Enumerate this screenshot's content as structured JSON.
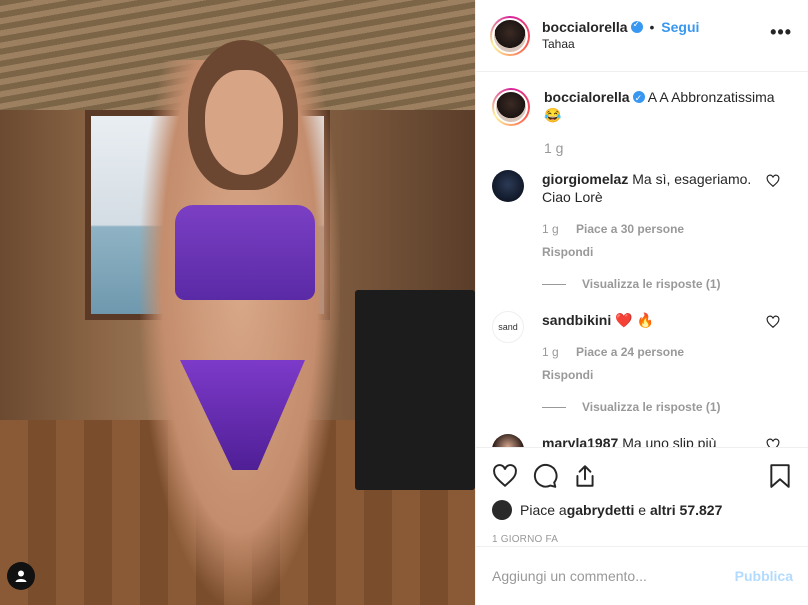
{
  "post": {
    "username": "boccialorella",
    "follow_label": "Segui",
    "separator": "•",
    "location": "Tahaa",
    "more_label": "•••"
  },
  "caption": {
    "username": "boccialorella",
    "text": "A A Abbronzatissima",
    "emoji": "😂",
    "time": "1 g"
  },
  "comments": [
    {
      "username": "giorgiomelaz",
      "text": "Ma sì, esageriamo. Ciao Lorè",
      "time": "1 g",
      "likes": "Piace a 30 persone",
      "reply_label": "Rispondi",
      "replies_label": "Visualizza le risposte (1)"
    },
    {
      "username": "sandbikini",
      "avatar_text": "sand",
      "text": "❤️",
      "text_extra": "🔥",
      "time": "1 g",
      "likes": "Piace a 24 persone",
      "reply_label": "Rispondi",
      "replies_label": "Visualizza le risposte (1)"
    },
    {
      "username": "maryla1987",
      "text": "Ma uno slip più coprente no??? Sei così bella che"
    }
  ],
  "likes_line": {
    "prefix": "Piace a ",
    "user": "gabrydetti",
    "middle": " e ",
    "others": "altri 57.827"
  },
  "time_ago": "1 GIORNO FA",
  "add_comment": {
    "placeholder": "Aggiungi un commento...",
    "publish_label": "Pubblica"
  },
  "colors": {
    "link_blue": "#3897f0",
    "publish_disabled": "#b3dbff",
    "muted": "#999999",
    "heart_red": "#ed4956"
  }
}
